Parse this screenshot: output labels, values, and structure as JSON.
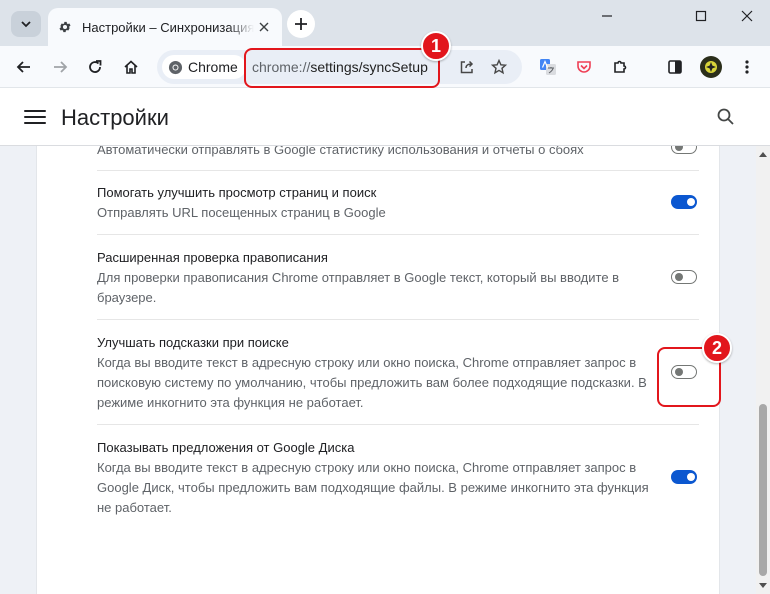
{
  "browser": {
    "tab_title": "Настройки – Синхронизация се",
    "chip_label": "Chrome",
    "url_prefix": "chrome://",
    "url_path": "settings/syncSetup"
  },
  "header": {
    "title": "Настройки"
  },
  "settings": {
    "partial_row_desc": "Автоматически отправлять в Google статистику использования и отчеты о сбоях",
    "rows": [
      {
        "title": "Помогать улучшить просмотр страниц и поиск",
        "desc": "Отправлять URL посещенных страниц в Google",
        "enabled": true
      },
      {
        "title": "Расширенная проверка правописания",
        "desc": "Для проверки правописания Chrome отправляет в Google текст, который вы вводите в браузере.",
        "enabled": false
      },
      {
        "title": "Улучшать подсказки при поиске",
        "desc": "Когда вы вводите текст в адресную строку или окно поиска, Chrome отправляет запрос в поисковую систему по умолчанию, чтобы предложить вам более подходящие подсказки. В режиме инкогнито эта функция не работает.",
        "enabled": false
      },
      {
        "title": "Показывать предложения от Google Диска",
        "desc": "Когда вы вводите текст в адресную строку или окно поиска, Chrome отправляет запрос в Google Диск, чтобы предложить вам подходящие файлы. В режиме инкогнито эта функция не работает.",
        "enabled": true
      }
    ]
  },
  "annotations": {
    "callout_1": "1",
    "callout_2": "2"
  },
  "colors": {
    "accent": "#0b57d0",
    "annotation": "#e2161c"
  }
}
